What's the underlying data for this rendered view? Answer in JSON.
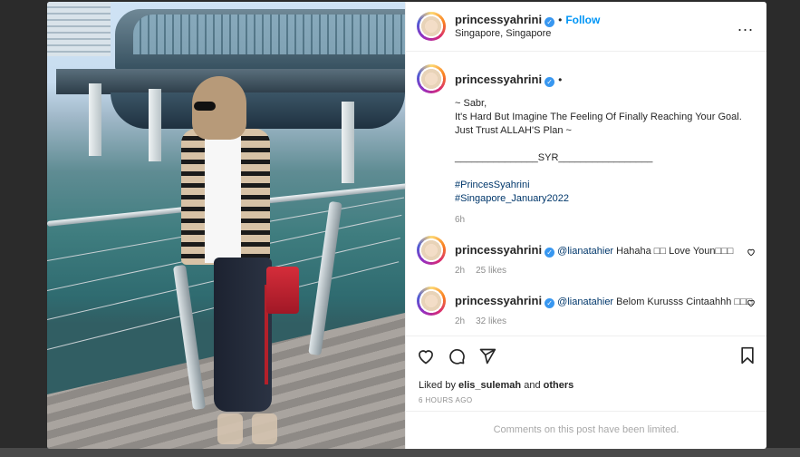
{
  "post": {
    "username": "princessyahrini",
    "verified_mark": "✓",
    "separator": "•",
    "follow_label": "Follow",
    "location": "Singapore, Singapore",
    "more_icon": "..."
  },
  "caption": {
    "username": "princessyahrini",
    "lines": [
      "~ Sabr,",
      "It's Hard But Imagine The Feeling Of Finally Reaching Your Goal.",
      "Just Trust ALLAH'S Plan ~",
      "_______________SYR_________________"
    ],
    "hashtags": [
      "#PrincesSyahrini",
      "#Singapore_January2022"
    ],
    "age": "6h"
  },
  "comments": [
    {
      "username": "princessyahrini",
      "mention": "@lianatahier",
      "text": "Hahaha □□ Love Youn□□□",
      "age": "2h",
      "likes": "25 likes"
    },
    {
      "username": "princessyahrini",
      "mention": "@lianatahier",
      "text": "Belom Kurusss Cintaahhh □□□",
      "age": "2h",
      "likes": "32 likes"
    }
  ],
  "likes_line": {
    "prefix": "Liked by",
    "user": "elis_sulemah",
    "connector": "and",
    "others": "others"
  },
  "timestamp": "6 HOURS AGO",
  "comments_limited": "Comments on this post have been limited.",
  "colors": {
    "accent": "#0095f6",
    "verified": "#3897f0",
    "link": "#00376b",
    "muted": "#8e8e8e"
  },
  "icons": [
    "heart-icon",
    "comment-icon",
    "share-icon",
    "bookmark-icon",
    "more-icon",
    "verified-icon"
  ]
}
